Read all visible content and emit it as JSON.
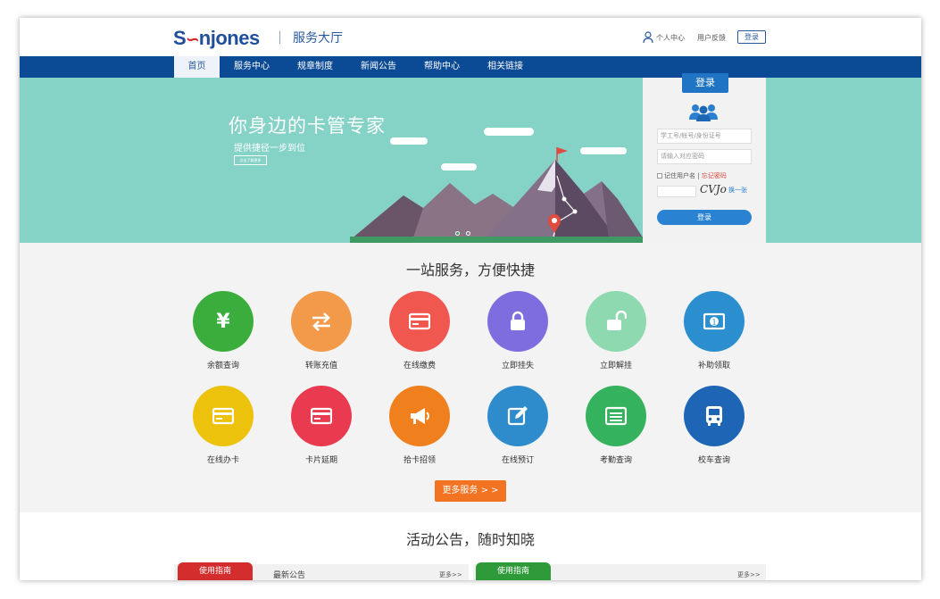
{
  "header": {
    "logo_text_1": "S",
    "logo_mark": "∽",
    "logo_text_2": "njones",
    "hall": "服务大厅",
    "user_center": "个人中心",
    "feedback": "用户反馈",
    "login": "登录"
  },
  "nav": {
    "items": [
      {
        "label": "首页"
      },
      {
        "label": "服务中心"
      },
      {
        "label": "规章制度"
      },
      {
        "label": "新闻公告"
      },
      {
        "label": "帮助中心"
      },
      {
        "label": "相关链接"
      }
    ]
  },
  "banner": {
    "title": "你身边的卡管专家",
    "subtitle": "提供捷径一步到位",
    "button": "点击了解更多"
  },
  "login": {
    "tab": "登录",
    "account_placeholder": "学工号/帐号/身份证号",
    "password_placeholder": "请输入对应密码",
    "remember": "记住用户名",
    "separator": "|",
    "forgot": "忘记密码",
    "captcha": "CVJo",
    "change": "换一张",
    "submit": "登录"
  },
  "services": {
    "title": "一站服务，方便快捷",
    "items": [
      {
        "label": "余额查询",
        "color": "#3aad3c",
        "icon": "yen-icon"
      },
      {
        "label": "转账充值",
        "color": "#f39a4a",
        "icon": "transfer-icon"
      },
      {
        "label": "在线缴费",
        "color": "#f0574f",
        "icon": "card-icon"
      },
      {
        "label": "立即挂失",
        "color": "#7d6ddf",
        "icon": "lock-icon"
      },
      {
        "label": "立即解挂",
        "color": "#8fd9b0",
        "icon": "unlock-icon"
      },
      {
        "label": "补助领取",
        "color": "#2b8fcf",
        "icon": "money-icon"
      },
      {
        "label": "在线办卡",
        "color": "#edc20c",
        "icon": "card-icon"
      },
      {
        "label": "卡片延期",
        "color": "#e93a50",
        "icon": "card-icon"
      },
      {
        "label": "拾卡招领",
        "color": "#f07f1d",
        "icon": "megaphone-icon"
      },
      {
        "label": "在线预订",
        "color": "#2f8ccc",
        "icon": "edit-icon"
      },
      {
        "label": "考勤查询",
        "color": "#35b25d",
        "icon": "list-icon"
      },
      {
        "label": "校车查询",
        "color": "#1f65b6",
        "icon": "bus-icon"
      }
    ],
    "more": "更多服务 > >"
  },
  "notices": {
    "title": "活动公告，随时知晓",
    "left_tag": "使用指南",
    "left_heading": "最新公告",
    "left_more": "更多>>",
    "right_tag": "使用指南",
    "right_more": "更多>>"
  }
}
